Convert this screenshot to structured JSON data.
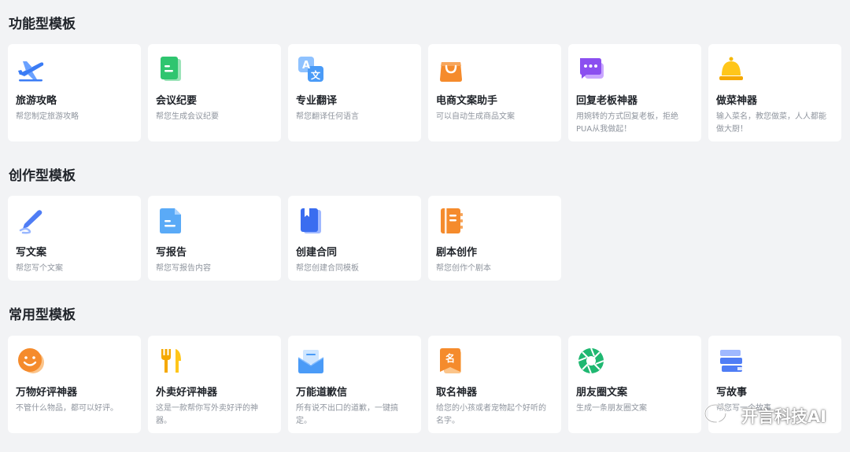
{
  "sections": [
    {
      "title": "功能型模板",
      "cards": [
        {
          "title": "旅游攻略",
          "desc": "帮您制定旅游攻略",
          "icon": "airplane-icon"
        },
        {
          "title": "会议纪要",
          "desc": "帮您生成会议纪要",
          "icon": "document-green-icon"
        },
        {
          "title": "专业翻译",
          "desc": "帮您翻译任何语言",
          "icon": "translate-icon"
        },
        {
          "title": "电商文案助手",
          "desc": "可以自动生成商品文案",
          "icon": "shopping-bag-icon"
        },
        {
          "title": "回复老板神器",
          "desc": "用婉转的方式回复老板，拒绝PUA从我做起！",
          "icon": "chat-bubble-icon"
        },
        {
          "title": "做菜神器",
          "desc": "输入菜名，教您做菜，人人都能做大厨！",
          "icon": "bell-icon"
        }
      ]
    },
    {
      "title": "创作型模板",
      "cards": [
        {
          "title": "写文案",
          "desc": "帮您写个文案",
          "icon": "pen-icon"
        },
        {
          "title": "写报告",
          "desc": "帮您写报告内容",
          "icon": "report-icon"
        },
        {
          "title": "创建合同",
          "desc": "帮您创建合同模板",
          "icon": "contract-book-icon"
        },
        {
          "title": "剧本创作",
          "desc": "帮您创作个剧本",
          "icon": "notebook-icon"
        }
      ]
    },
    {
      "title": "常用型模板",
      "cards": [
        {
          "title": "万物好评神器",
          "desc": "不管什么物品，都可以好评。",
          "icon": "smiley-icon"
        },
        {
          "title": "外卖好评神器",
          "desc": "这是一款帮你写外卖好评的神器。",
          "icon": "fork-knife-icon"
        },
        {
          "title": "万能道歉信",
          "desc": "所有说不出口的道歉，一键搞定。",
          "icon": "envelope-icon"
        },
        {
          "title": "取名神器",
          "desc": "给您的小孩或者宠物起个好听的名字。",
          "icon": "name-tag-icon"
        },
        {
          "title": "朋友圈文案",
          "desc": "生成一条朋友圈文案",
          "icon": "camera-aperture-icon"
        },
        {
          "title": "写故事",
          "desc": "帮您写一个故事",
          "icon": "books-stack-icon"
        }
      ]
    }
  ],
  "watermark": {
    "text": "开言科技AI",
    "icon": "wechat-logo-icon"
  }
}
